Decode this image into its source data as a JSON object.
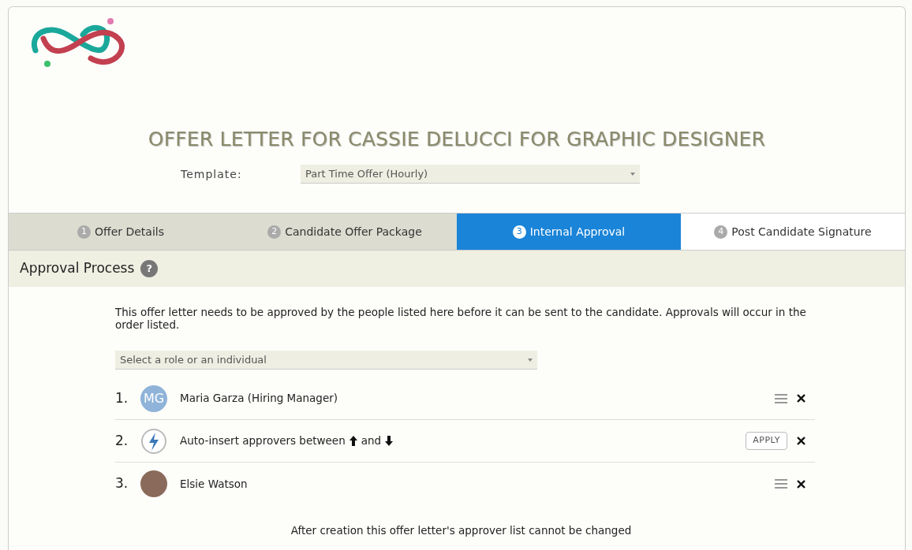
{
  "title": "OFFER LETTER FOR CASSIE DELUCCI FOR GRAPHIC DESIGNER",
  "template": {
    "label": "Template:",
    "value": "Part Time Offer (Hourly)"
  },
  "steps": [
    {
      "number": "1",
      "label": "Offer Details",
      "selected": false,
      "completed": true
    },
    {
      "number": "2",
      "label": "Candidate Offer Package",
      "selected": false,
      "completed": true
    },
    {
      "number": "3",
      "label": "Internal Approval",
      "selected": true
    },
    {
      "number": "4",
      "label": "Post Candidate Signature",
      "selected": false,
      "completed": false
    }
  ],
  "section": {
    "title": "Approval Process",
    "help": "?"
  },
  "intro": "This offer letter needs to be approved by the people listed here before it can be sent to the candidate. Approvals will occur in the order listed.",
  "approver_select": {
    "placeholder": "Select a role or an individual"
  },
  "approvers": [
    {
      "kind": "person",
      "index": "1.",
      "initials": "MG",
      "name": "Maria Garza (Hiring Manager)"
    },
    {
      "kind": "auto",
      "index": "2.",
      "text_before": "Auto-insert approvers between",
      "text_middle": "and",
      "action": "APPLY"
    },
    {
      "kind": "person",
      "index": "3.",
      "photo": true,
      "name": "Elsie Watson"
    }
  ],
  "footer_note": "After creation this offer letter's approver list cannot be changed"
}
